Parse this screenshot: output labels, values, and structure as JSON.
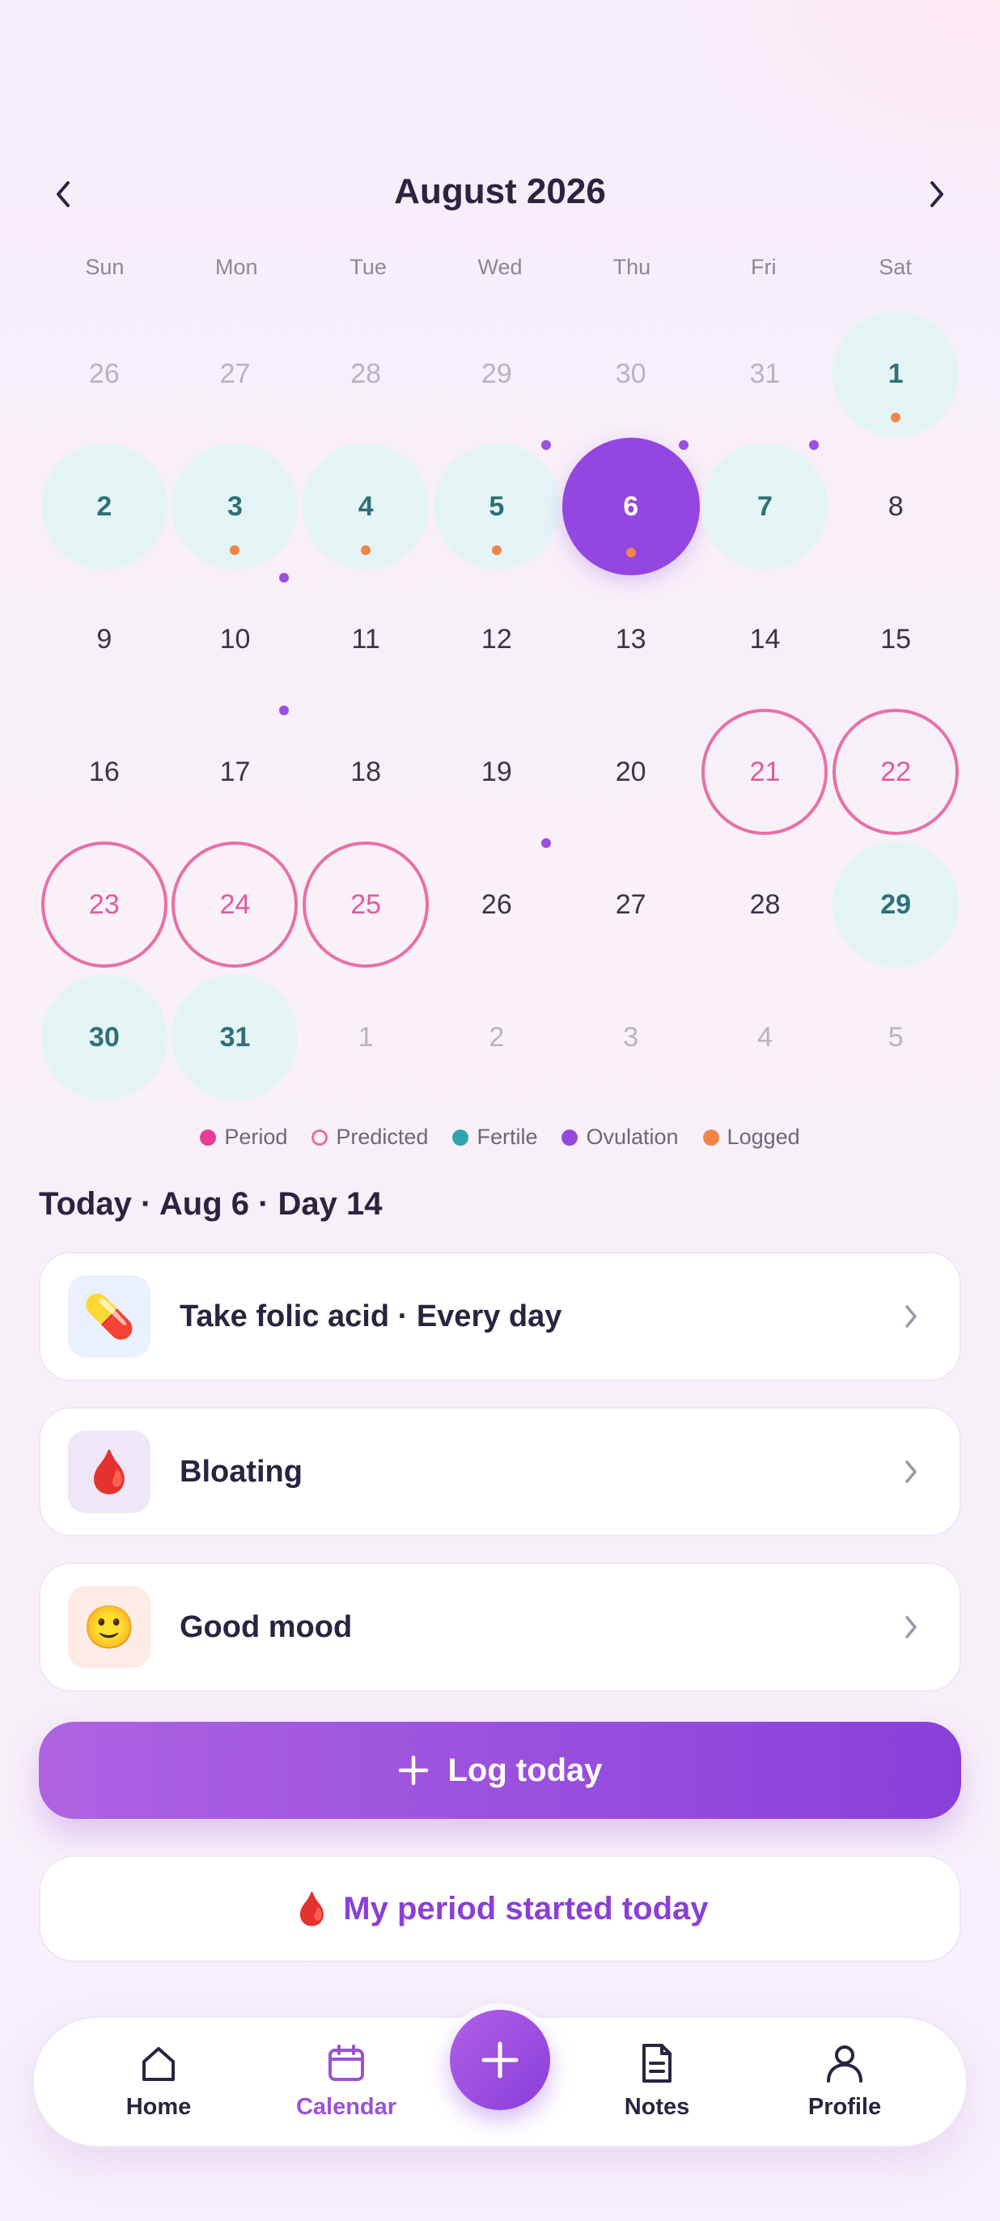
{
  "calendar": {
    "month_title": "August 2026",
    "weekdays": [
      "Sun",
      "Mon",
      "Tue",
      "Wed",
      "Thu",
      "Fri",
      "Sat"
    ],
    "days": [
      {
        "n": "26",
        "state": "muted"
      },
      {
        "n": "27",
        "state": "muted"
      },
      {
        "n": "28",
        "state": "muted"
      },
      {
        "n": "29",
        "state": "muted"
      },
      {
        "n": "30",
        "state": "muted"
      },
      {
        "n": "31",
        "state": "muted"
      },
      {
        "n": "1",
        "state": "fertile",
        "logged": true
      },
      {
        "n": "2",
        "state": "fertile"
      },
      {
        "n": "3",
        "state": "fertile",
        "logged": true
      },
      {
        "n": "4",
        "state": "fertile",
        "logged": true
      },
      {
        "n": "5",
        "state": "fertile",
        "logged": true
      },
      {
        "n": "6",
        "state": "today",
        "logged": true
      },
      {
        "n": "7",
        "state": "fertile"
      },
      {
        "n": "8",
        "state": "normal"
      },
      {
        "n": "9",
        "state": "normal"
      },
      {
        "n": "10",
        "state": "normal"
      },
      {
        "n": "11",
        "state": "normal"
      },
      {
        "n": "12",
        "state": "normal"
      },
      {
        "n": "13",
        "state": "normal"
      },
      {
        "n": "14",
        "state": "normal"
      },
      {
        "n": "15",
        "state": "normal"
      },
      {
        "n": "16",
        "state": "normal"
      },
      {
        "n": "17",
        "state": "normal"
      },
      {
        "n": "18",
        "state": "normal"
      },
      {
        "n": "19",
        "state": "normal"
      },
      {
        "n": "20",
        "state": "normal"
      },
      {
        "n": "21",
        "state": "predicted"
      },
      {
        "n": "22",
        "state": "predicted"
      },
      {
        "n": "23",
        "state": "predicted"
      },
      {
        "n": "24",
        "state": "predicted"
      },
      {
        "n": "25",
        "state": "predicted"
      },
      {
        "n": "26",
        "state": "normal"
      },
      {
        "n": "27",
        "state": "normal"
      },
      {
        "n": "28",
        "state": "normal"
      },
      {
        "n": "29",
        "state": "fertile"
      },
      {
        "n": "30",
        "state": "fertile"
      },
      {
        "n": "31",
        "state": "fertile"
      },
      {
        "n": "1",
        "state": "muted"
      },
      {
        "n": "2",
        "state": "muted"
      },
      {
        "n": "3",
        "state": "muted"
      },
      {
        "n": "4",
        "state": "muted"
      },
      {
        "n": "5",
        "state": "muted"
      }
    ],
    "ovulation_marker_days": [
      "5",
      "6",
      "7",
      "10",
      "17",
      "26"
    ]
  },
  "legend": [
    {
      "key": "period",
      "label": "Period"
    },
    {
      "key": "predicted",
      "label": "Predicted"
    },
    {
      "key": "fertile",
      "label": "Fertile"
    },
    {
      "key": "ovulation",
      "label": "Ovulation"
    },
    {
      "key": "logged",
      "label": "Logged"
    }
  ],
  "today": {
    "title": "Today · Aug 6 · Day 14",
    "cards": [
      {
        "label": "Take folic acid · Every day",
        "icon": "pill-icon",
        "glyph": "💊",
        "bg": "#eaf1fd"
      },
      {
        "label": "Bloating",
        "icon": "blood-drop-icon",
        "glyph": "🩸",
        "bg": "#efe6f8"
      },
      {
        "label": "Good mood",
        "icon": "smile-icon",
        "glyph": "🙂",
        "bg": "#fdece6"
      }
    ]
  },
  "actions": {
    "log_today": "Log today",
    "period_started": "My period started today",
    "period_glyph": "🩸"
  },
  "bottom_nav": {
    "items": [
      {
        "label": "Home",
        "icon": "home-icon"
      },
      {
        "label": "Calendar",
        "icon": "calendar-icon",
        "active": true
      },
      {
        "label": "Notes",
        "icon": "notes-icon"
      },
      {
        "label": "Profile",
        "icon": "profile-icon"
      }
    ]
  },
  "colors": {
    "accent": "#9346e0",
    "predicted": "#e86fa8",
    "fertile_bg": "#e4f4f5",
    "logged": "#f08548"
  }
}
